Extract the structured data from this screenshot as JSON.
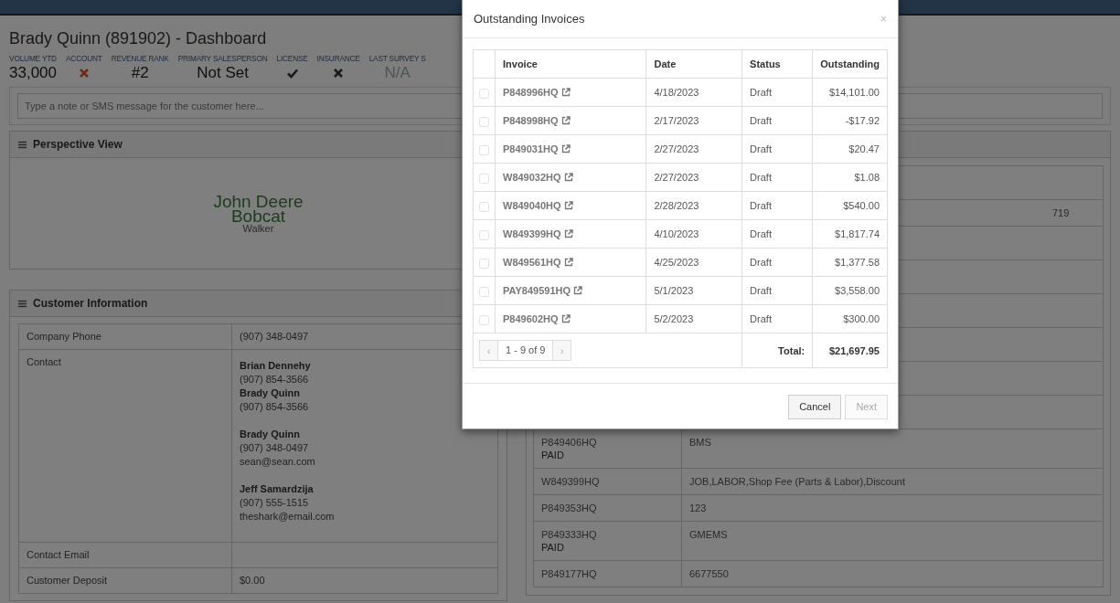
{
  "page_title": "Brady Quinn (891902) - Dashboard",
  "stats": [
    {
      "label": "VOLUME YTD",
      "kind": "text",
      "value": "33,000",
      "muted": false
    },
    {
      "label": "ACCOUNT",
      "kind": "alert",
      "ok": false
    },
    {
      "label": "REVENUE RANK",
      "kind": "text",
      "value": "#2",
      "muted": false
    },
    {
      "label": "PRIMARY SALESPERSON",
      "kind": "text",
      "value": "Not Set",
      "muted": false
    },
    {
      "label": "LICENSE",
      "kind": "mark",
      "ok": true
    },
    {
      "label": "INSURANCE",
      "kind": "mark",
      "ok": false
    },
    {
      "label": "LAST SURVEY S",
      "kind": "text",
      "value": "N/A",
      "muted": true
    }
  ],
  "note": {
    "placeholder": "Type a note or SMS message for the customer here..."
  },
  "perspective_view": {
    "title": "Perspective View",
    "words": [
      {
        "text": "John Deere",
        "kind": "large"
      },
      {
        "text": "Bobcat",
        "kind": "large"
      },
      {
        "text": "Walker",
        "kind": "small"
      }
    ]
  },
  "customer_information": {
    "title": "Customer Information",
    "rows": [
      {
        "kind": "text",
        "label": "Company Phone",
        "value": "(907) 348-0497"
      },
      {
        "kind": "contacts",
        "label": "Contact",
        "contact_groups": [
          {
            "contacts": [
              {
                "name": "Brian Dennehy",
                "phone": "(907) 854-3566"
              },
              {
                "name": "Brady Quinn",
                "phone": "(907) 854-3566"
              }
            ]
          },
          {
            "contacts": [
              {
                "name": "Brady Quinn",
                "phone": "(907) 348-0497",
                "email": "sean@sean.com"
              }
            ]
          },
          {
            "contacts": [
              {
                "name": "Jeff Samardzija",
                "phone": "(907) 555-1515",
                "email": "theshark@email.com"
              }
            ]
          }
        ]
      },
      {
        "kind": "text",
        "label": "Contact Email"
      },
      {
        "kind": "text",
        "label": "Customer Deposit",
        "value": "$0.00"
      }
    ]
  },
  "invoice_history": {
    "rows": [
      {
        "kind": "blank"
      },
      {
        "kind": "tail",
        "text": "719"
      },
      {
        "kind": "blank"
      },
      {
        "kind": "blank"
      },
      {
        "kind": "blank"
      },
      {
        "kind": "blank"
      },
      {
        "kind": "blank"
      },
      {
        "kind": "blank"
      },
      {
        "kind": "invoice",
        "invoice": "P849406HQ",
        "status": "PAID",
        "description": "BMS"
      },
      {
        "kind": "invoice",
        "invoice": "W849399HQ",
        "description": "JOB,LABOR,Shop Fee (Parts & Labor),Discount"
      },
      {
        "kind": "invoice",
        "invoice": "P849353HQ",
        "description": "123"
      },
      {
        "kind": "invoice",
        "invoice": "P849333HQ",
        "status": "PAID",
        "description": "GMEMS"
      },
      {
        "kind": "invoice",
        "invoice": "P849177HQ",
        "description": "6677550"
      }
    ]
  },
  "modal": {
    "title": "Outstanding Invoices",
    "close": "×",
    "columns": [
      "Invoice",
      "Date",
      "Status",
      "Outstanding"
    ],
    "rows": [
      {
        "invoice": "P848996HQ",
        "date": "4/18/2023",
        "status": "Draft",
        "outstanding": "$14,101.00",
        "checked": false
      },
      {
        "invoice": "P848998HQ",
        "date": "2/17/2023",
        "status": "Draft",
        "outstanding": "-$17.92",
        "checked": false
      },
      {
        "invoice": "P849031HQ",
        "date": "2/27/2023",
        "status": "Draft",
        "outstanding": "$20.47",
        "checked": false
      },
      {
        "invoice": "W849032HQ",
        "date": "2/27/2023",
        "status": "Draft",
        "outstanding": "$1.08",
        "checked": false
      },
      {
        "invoice": "W849040HQ",
        "date": "2/28/2023",
        "status": "Draft",
        "outstanding": "$540.00",
        "checked": false
      },
      {
        "invoice": "W849399HQ",
        "date": "4/10/2023",
        "status": "Draft",
        "outstanding": "$1,817.74",
        "checked": false
      },
      {
        "invoice": "W849561HQ",
        "date": "4/25/2023",
        "status": "Draft",
        "outstanding": "$1,377.58",
        "checked": false
      },
      {
        "invoice": "PAY849591HQ",
        "date": "5/1/2023",
        "status": "Draft",
        "outstanding": "$3,558.00",
        "checked": false
      },
      {
        "invoice": "P849602HQ",
        "date": "5/2/2023",
        "status": "Draft",
        "outstanding": "$300.00",
        "checked": false
      }
    ],
    "pager": {
      "prev": "‹",
      "label": "1 - 9 of 9",
      "next": "›"
    },
    "total_label": "Total:",
    "total": "$21,697.95",
    "buttons": [
      {
        "label": "Cancel",
        "disabled": false
      },
      {
        "label": "Next",
        "disabled": true
      }
    ]
  }
}
